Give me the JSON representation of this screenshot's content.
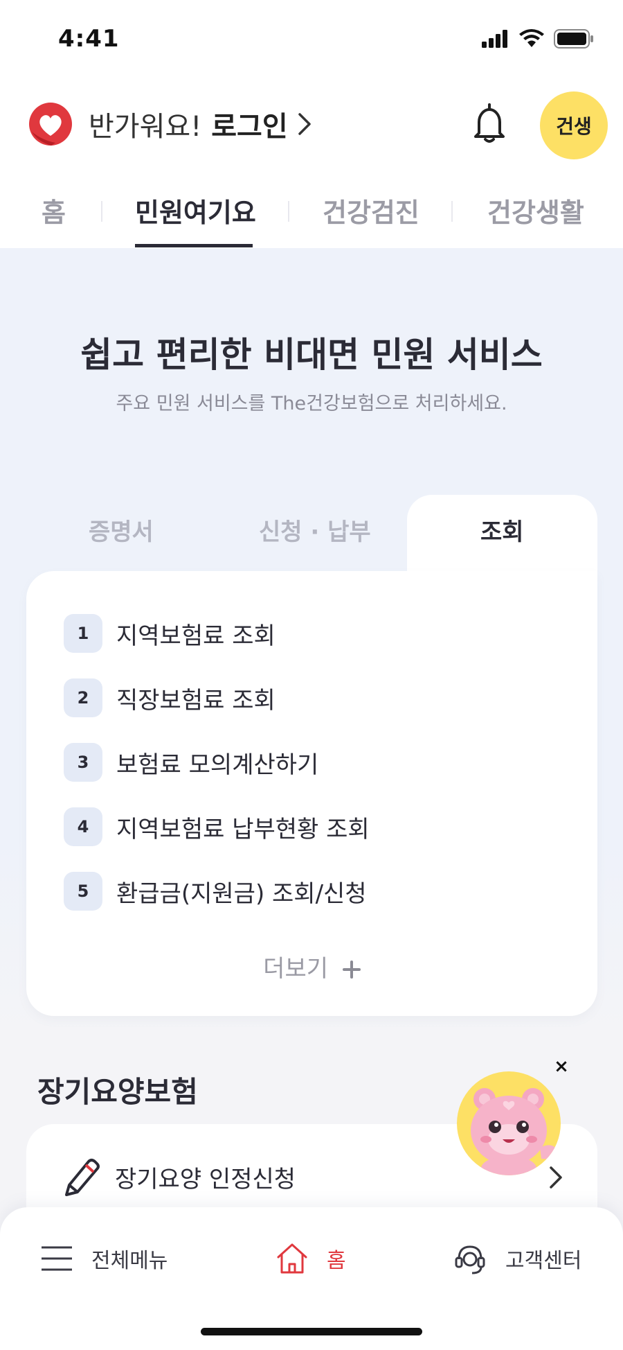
{
  "status_bar": {
    "time": "4:41",
    "icons": [
      "cellular-signal-icon",
      "wifi-icon",
      "battery-icon"
    ]
  },
  "header": {
    "greeting": "반가워요!",
    "login_label": "로그인",
    "chevron_icon": "chevron-right-icon",
    "bell_icon": "bell-icon",
    "badge_label": "건생"
  },
  "tabs": [
    {
      "label": "홈",
      "active": false
    },
    {
      "label": "민원여기요",
      "active": true
    },
    {
      "label": "건강검진",
      "active": false
    },
    {
      "label": "건강생활",
      "active": false
    }
  ],
  "hero": {
    "title": "쉽고 편리한 비대면 민원 서비스",
    "subtitle": "주요 민원 서비스를 The건강보험으로 처리하세요."
  },
  "subtabs": [
    {
      "label": "증명서",
      "active": false
    },
    {
      "label": "신청 · 납부",
      "active": false
    },
    {
      "label": "조회",
      "active": true
    }
  ],
  "list": {
    "items": [
      {
        "num": "1",
        "label": "지역보험료 조회"
      },
      {
        "num": "2",
        "label": "직장보험료 조회"
      },
      {
        "num": "3",
        "label": "보험료 모의계산하기"
      },
      {
        "num": "4",
        "label": "지역보험료 납부현황 조회"
      },
      {
        "num": "5",
        "label": "환급금(지원금) 조회/신청"
      }
    ],
    "more_label": "더보기",
    "more_icon": "plus-icon"
  },
  "long_term_care": {
    "title": "장기요양보험",
    "item_label": "장기요양 인정신청",
    "item_icon": "pencil-icon"
  },
  "mascot": {
    "close_label": "×"
  },
  "bottom_nav": {
    "menu_label": "전체메뉴",
    "home_label": "홈",
    "support_label": "고객센터"
  },
  "colors": {
    "accent_red": "#e0383e",
    "badge_yellow": "#fde065",
    "text_dark": "#2b2b36",
    "bg_light": "#eef2fa"
  }
}
